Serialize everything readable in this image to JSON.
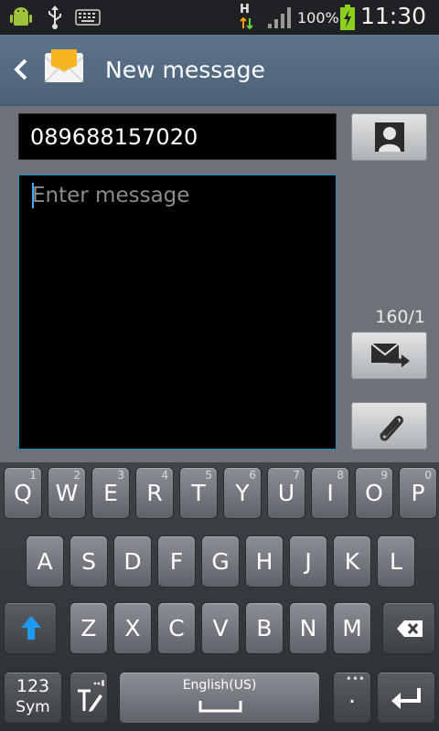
{
  "status_bar": {
    "network_type": "H",
    "battery_percent": "100%",
    "time": "11:30"
  },
  "action_bar": {
    "title": "New message"
  },
  "compose": {
    "recipient_value": "089688157020",
    "message_placeholder": "Enter message",
    "char_counter": "160/1",
    "accent_color": "#1a8fc4"
  },
  "keyboard": {
    "row1": [
      {
        "label": "Q",
        "hint": "1"
      },
      {
        "label": "W",
        "hint": "2"
      },
      {
        "label": "E",
        "hint": "3"
      },
      {
        "label": "R",
        "hint": "4"
      },
      {
        "label": "T",
        "hint": "5"
      },
      {
        "label": "Y",
        "hint": "6"
      },
      {
        "label": "U",
        "hint": "7"
      },
      {
        "label": "I",
        "hint": "8"
      },
      {
        "label": "O",
        "hint": "9"
      },
      {
        "label": "P",
        "hint": "0"
      }
    ],
    "row2": [
      "A",
      "S",
      "D",
      "F",
      "G",
      "H",
      "J",
      "K",
      "L"
    ],
    "row3": [
      "Z",
      "X",
      "C",
      "V",
      "B",
      "N",
      "M"
    ],
    "sym_top": "123",
    "sym_bottom": "Sym",
    "space_label": "English(US)",
    "period_label": ".",
    "shift_color": "#1c9bf0"
  }
}
